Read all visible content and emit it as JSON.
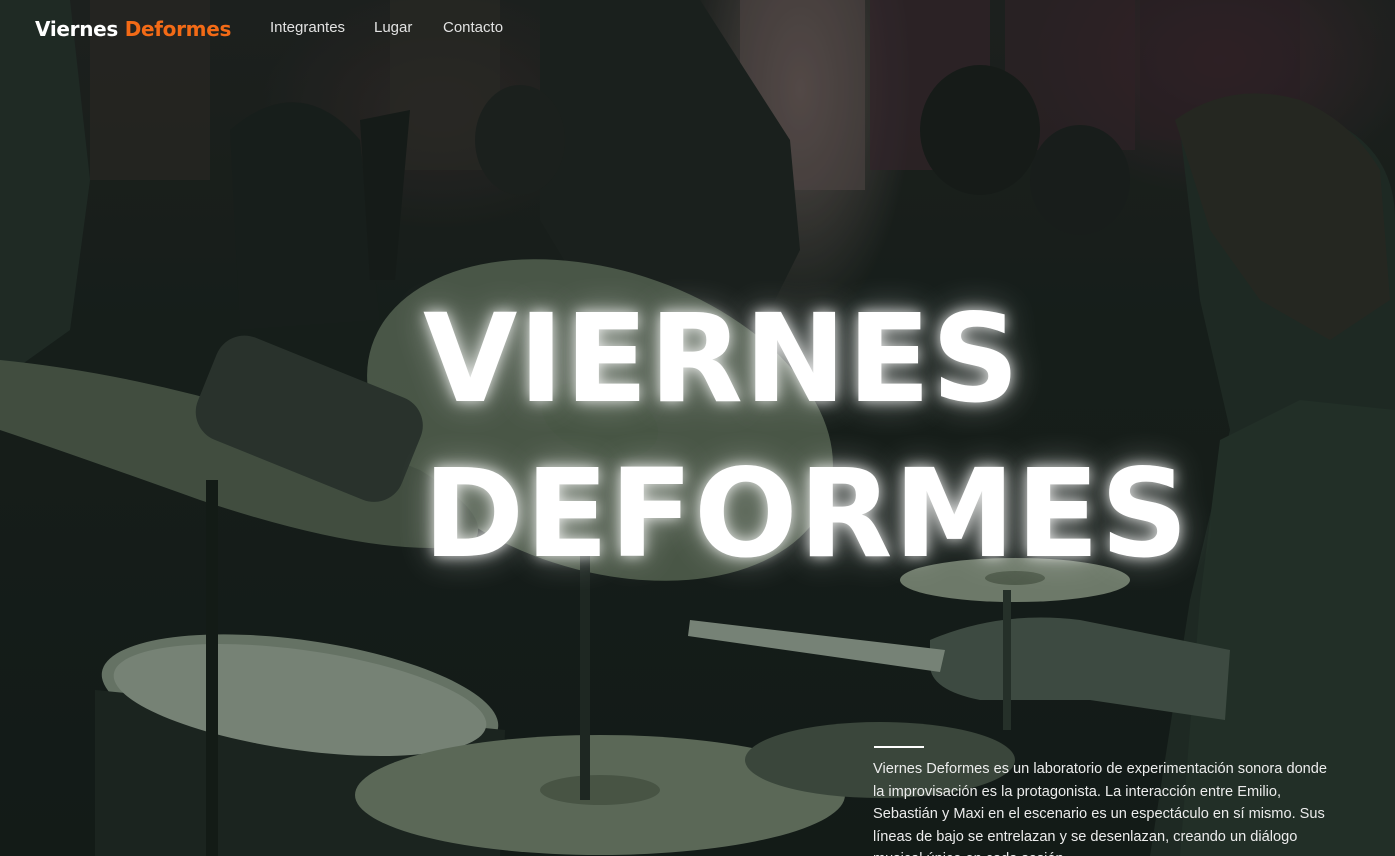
{
  "navbar": {
    "brand_first": "Viernes",
    "brand_second": "Deformes",
    "links": [
      {
        "label": "Integrantes"
      },
      {
        "label": "Lugar"
      },
      {
        "label": "Contacto"
      }
    ]
  },
  "hero": {
    "title_line1": "VIERNES",
    "title_line2": "DEFORMES",
    "description": "Viernes Deformes es un laboratorio de experimentación sonora donde la improvisación es la protagonista. La interacción entre Emilio, Sebastián y Maxi en el escenario es un espectáculo en sí mismo. Sus líneas de bajo se entrelazan y se desenlazan, creando un diálogo musical único en cada sesión."
  },
  "colors": {
    "accent": "#f36a16",
    "text": "#ffffff",
    "photo_tint": "#3e5a4c"
  }
}
